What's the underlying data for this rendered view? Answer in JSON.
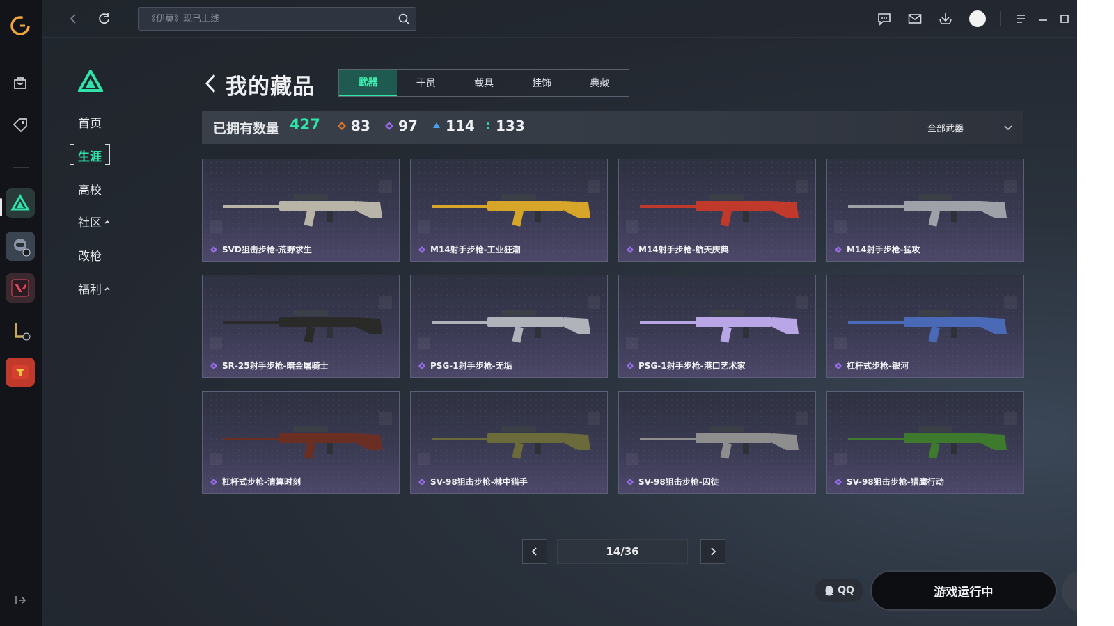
{
  "topbar": {
    "search_placeholder": "《伊莫》现已上线",
    "icons": [
      "back-icon",
      "refresh-icon",
      "search-icon",
      "chat-icon",
      "mail-icon",
      "download-icon",
      "avatar",
      "menu-icon",
      "minimize-icon",
      "maximize-icon"
    ]
  },
  "subnav": {
    "items": [
      "首页",
      "生涯",
      "高校",
      "社区",
      "改枪",
      "福利"
    ],
    "active": "生涯"
  },
  "header": {
    "title": "我的藏品",
    "tabs": [
      "武器",
      "干员",
      "载具",
      "挂饰",
      "典藏"
    ],
    "active_tab": "武器"
  },
  "stats": {
    "owned_label": "已拥有数量",
    "owned_count": "427",
    "tiers": [
      {
        "value": "83",
        "color": "#e0762e"
      },
      {
        "value": "97",
        "color": "#9c6cf0"
      },
      {
        "value": "114",
        "color": "#4aa0ee"
      },
      {
        "value": "133",
        "color": "#3ad6a0"
      }
    ],
    "filter": "全部武器"
  },
  "items": [
    {
      "name": "SVD狙击步枪-荒野求生",
      "gun_color": "#b8b4a8"
    },
    {
      "name": "M14射手步枪-工业狂潮",
      "gun_color": "#d6a52a"
    },
    {
      "name": "M14射手步枪-航天庆典",
      "gun_color": "#c0392b"
    },
    {
      "name": "M14射手步枪-猛攻",
      "gun_color": "#9ea2a8"
    },
    {
      "name": "SR-25射手步枪-暗金屠骑士",
      "gun_color": "#2a2a28"
    },
    {
      "name": "PSG-1射手步枪-无垢",
      "gun_color": "#b0b4ba"
    },
    {
      "name": "PSG-1射手步枪-港口艺术家",
      "gun_color": "#b9a6e6"
    },
    {
      "name": "杠杆式步枪-银河",
      "gun_color": "#4a6ab8"
    },
    {
      "name": "杠杆式步枪-清算时刻",
      "gun_color": "#6a2e22"
    },
    {
      "name": "SV-98狙击步枪-林中猎手",
      "gun_color": "#6b6a3a"
    },
    {
      "name": "SV-98狙击步枪-囚徒",
      "gun_color": "#8e8e8e"
    },
    {
      "name": "SV-98狙击步枪-猎鹰行动",
      "gun_color": "#3e7a2e"
    }
  ],
  "pagination": {
    "label": "14/36"
  },
  "footer": {
    "qq_label": "QQ",
    "running_label": "游戏运行中"
  },
  "colors": {
    "accent": "#2fe4a8",
    "gem": "#9c6cf0"
  }
}
